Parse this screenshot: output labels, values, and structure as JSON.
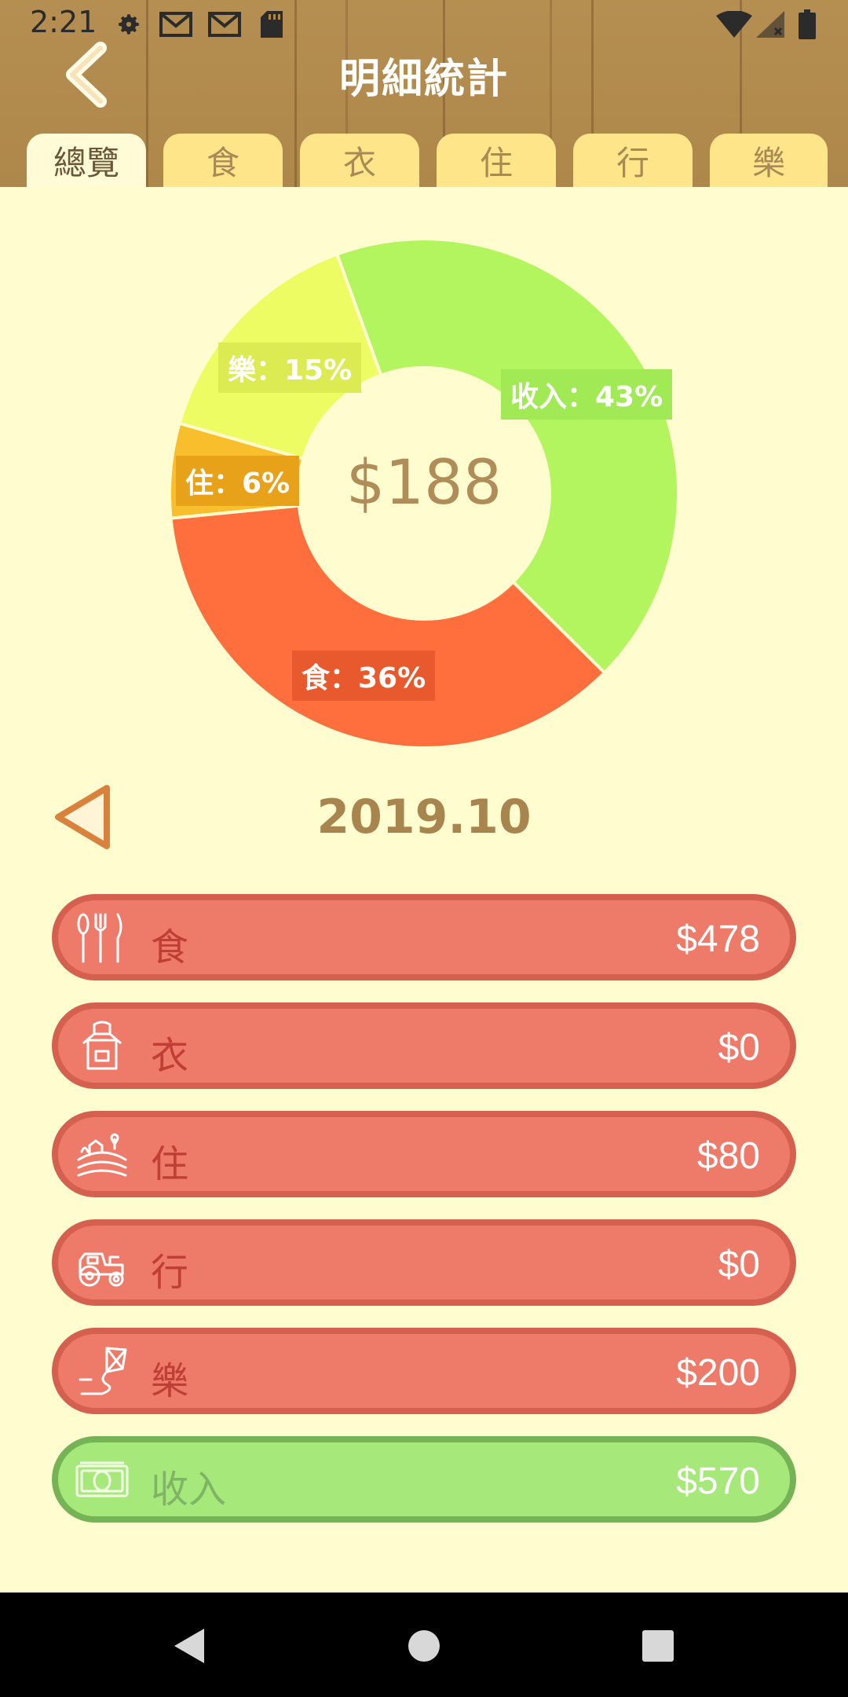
{
  "status_bar": {
    "time": "2:21"
  },
  "header": {
    "title": "明細統計"
  },
  "tabs": [
    {
      "label": "總覽",
      "active": true
    },
    {
      "label": "食",
      "active": false
    },
    {
      "label": "衣",
      "active": false
    },
    {
      "label": "住",
      "active": false
    },
    {
      "label": "行",
      "active": false
    },
    {
      "label": "樂",
      "active": false
    }
  ],
  "chart_data": {
    "type": "pie",
    "center_label": "$188",
    "slices": [
      {
        "label": "收入：43%",
        "name": "收入",
        "value": 43,
        "color": "#B3F55F"
      },
      {
        "label": "食：36%",
        "name": "食",
        "value": 36,
        "color": "#FF6F3E"
      },
      {
        "label": "住：6%",
        "name": "住",
        "value": 6,
        "color": "#F8BE2C"
      },
      {
        "label": "樂：15%",
        "name": "樂",
        "value": 15,
        "color": "#EEFC64"
      }
    ]
  },
  "month": {
    "label": "2019.10"
  },
  "categories": [
    {
      "icon": "fork-knife-icon",
      "label": "食",
      "amount": "$478",
      "type": "expense"
    },
    {
      "icon": "apron-icon",
      "label": "衣",
      "amount": "$0",
      "type": "expense"
    },
    {
      "icon": "farm-field-icon",
      "label": "住",
      "amount": "$80",
      "type": "expense"
    },
    {
      "icon": "tractor-icon",
      "label": "行",
      "amount": "$0",
      "type": "expense"
    },
    {
      "icon": "kite-icon",
      "label": "樂",
      "amount": "$200",
      "type": "expense"
    },
    {
      "icon": "money-bill-icon",
      "label": "收入",
      "amount": "$570",
      "type": "income"
    }
  ],
  "colors": {
    "background": "#FFFDD0",
    "expense_row": "#EE7B6A",
    "income_row": "#A6E97A",
    "accent_text": "#A8854E"
  }
}
